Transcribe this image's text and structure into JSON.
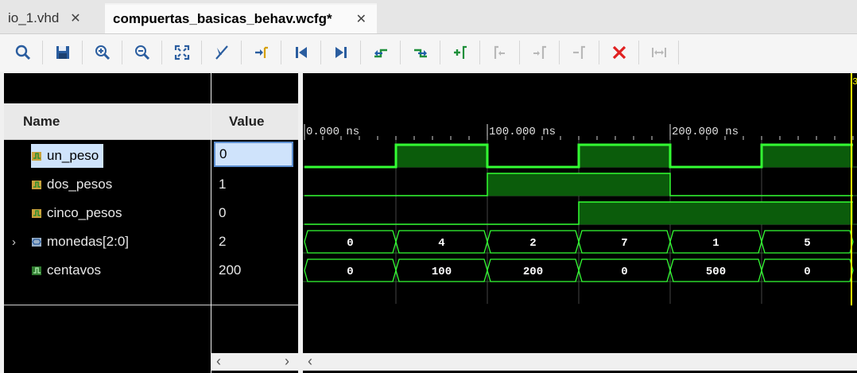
{
  "tabs": [
    {
      "label": "io_1.vhd",
      "close": "✕",
      "active": false
    },
    {
      "label": "compuertas_basicas_behav.wcfg*",
      "close": "✕",
      "active": true
    }
  ],
  "toolbar": {
    "buttons": [
      "search-icon",
      "save-icon",
      "zoom-in-icon",
      "zoom-out-icon",
      "zoom-fit-icon",
      "cursor-icon",
      "goto-cursor-icon",
      "goto-start-icon",
      "goto-end-icon",
      "prev-transition-icon",
      "next-transition-icon",
      "add-marker-icon",
      "prev-marker-icon",
      "next-marker-icon",
      "remove-marker-icon",
      "delete-icon",
      "swap-cursor-icon"
    ]
  },
  "columns": {
    "name": "Name",
    "value": "Value"
  },
  "signals": [
    {
      "name": "un_peso",
      "value": "0",
      "selected": true,
      "expandable": false,
      "type": "bit"
    },
    {
      "name": "dos_pesos",
      "value": "1",
      "selected": false,
      "expandable": false,
      "type": "bit"
    },
    {
      "name": "cinco_pesos",
      "value": "0",
      "selected": false,
      "expandable": false,
      "type": "bit"
    },
    {
      "name": "monedas[2:0]",
      "value": "2",
      "selected": false,
      "expandable": true,
      "type": "bus"
    },
    {
      "name": "centavos",
      "value": "200",
      "selected": false,
      "expandable": false,
      "type": "int"
    }
  ],
  "timeline": {
    "labels": [
      "0.000 ns",
      "100.000 ns",
      "200.000 ns"
    ],
    "cursor_label": "3"
  },
  "waves": {
    "un_peso": [
      0,
      1,
      0,
      1,
      0,
      1
    ],
    "dos_pesos": [
      0,
      0,
      1,
      1,
      0,
      0
    ],
    "cinco_pesos": [
      0,
      0,
      0,
      1,
      1,
      1
    ],
    "monedas": [
      "0",
      "4",
      "2",
      "7",
      "1",
      "5"
    ],
    "centavos": [
      "0",
      "100",
      "200",
      "0",
      "500",
      "0"
    ]
  },
  "colors": {
    "wave": "#33ff33",
    "fill": "#0b5c0b",
    "cursor": "#ffff00",
    "bg": "#000000"
  }
}
